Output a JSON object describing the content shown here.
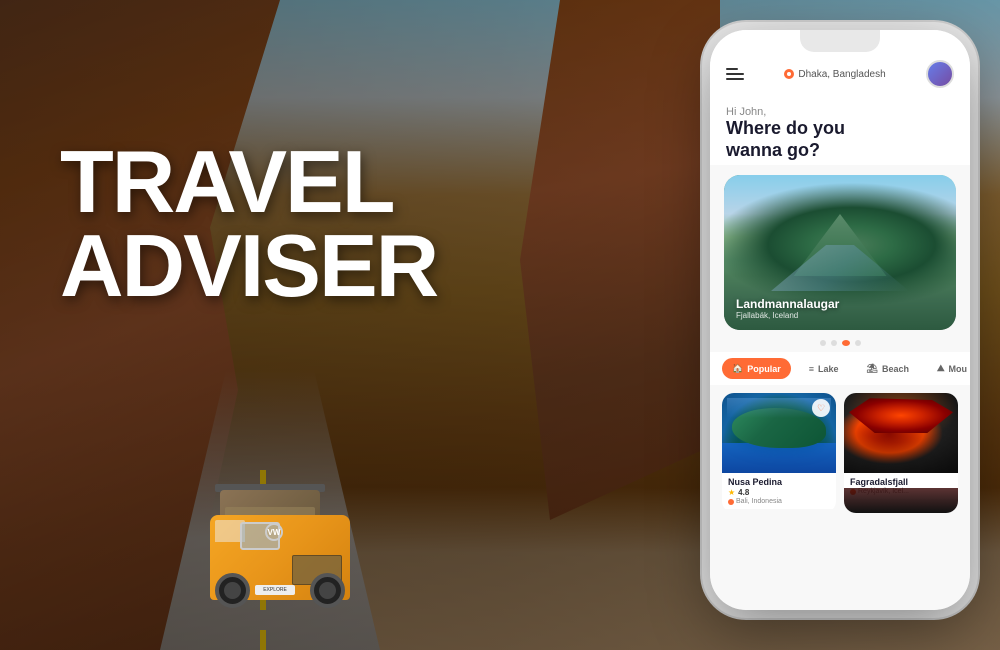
{
  "page": {
    "title": "Travel Adviser",
    "background": {
      "description": "Desert canyon road with yellow VW van"
    }
  },
  "hero_title": {
    "line1": "TRAVEL",
    "line2": "ADVISER"
  },
  "app": {
    "header": {
      "location": "Dhaka, Bangladesh",
      "menu_icon": "≡"
    },
    "greeting": {
      "sub": "Hi John,",
      "main_line1": "Where do you",
      "main_line2": "wanna go?"
    },
    "hero_card": {
      "name": "Landmannalaugar",
      "sub": "Fjallabák, Iceland"
    },
    "dots": [
      "inactive",
      "inactive",
      "active",
      "inactive"
    ],
    "categories": [
      {
        "label": "Popular",
        "icon": "🏠",
        "active": true
      },
      {
        "label": "Lake",
        "icon": "≡",
        "active": false
      },
      {
        "label": "Beach",
        "icon": "⛱",
        "active": false
      },
      {
        "label": "Mou",
        "icon": "⛰",
        "active": false
      }
    ],
    "destinations": [
      {
        "name": "Nusa Pedina",
        "location": "Bali, Indonesia",
        "rating": "4.8",
        "type": "island"
      },
      {
        "name": "Fagradalsfjall",
        "location": "Reykjavík, Icel...",
        "type": "volcano"
      }
    ]
  }
}
